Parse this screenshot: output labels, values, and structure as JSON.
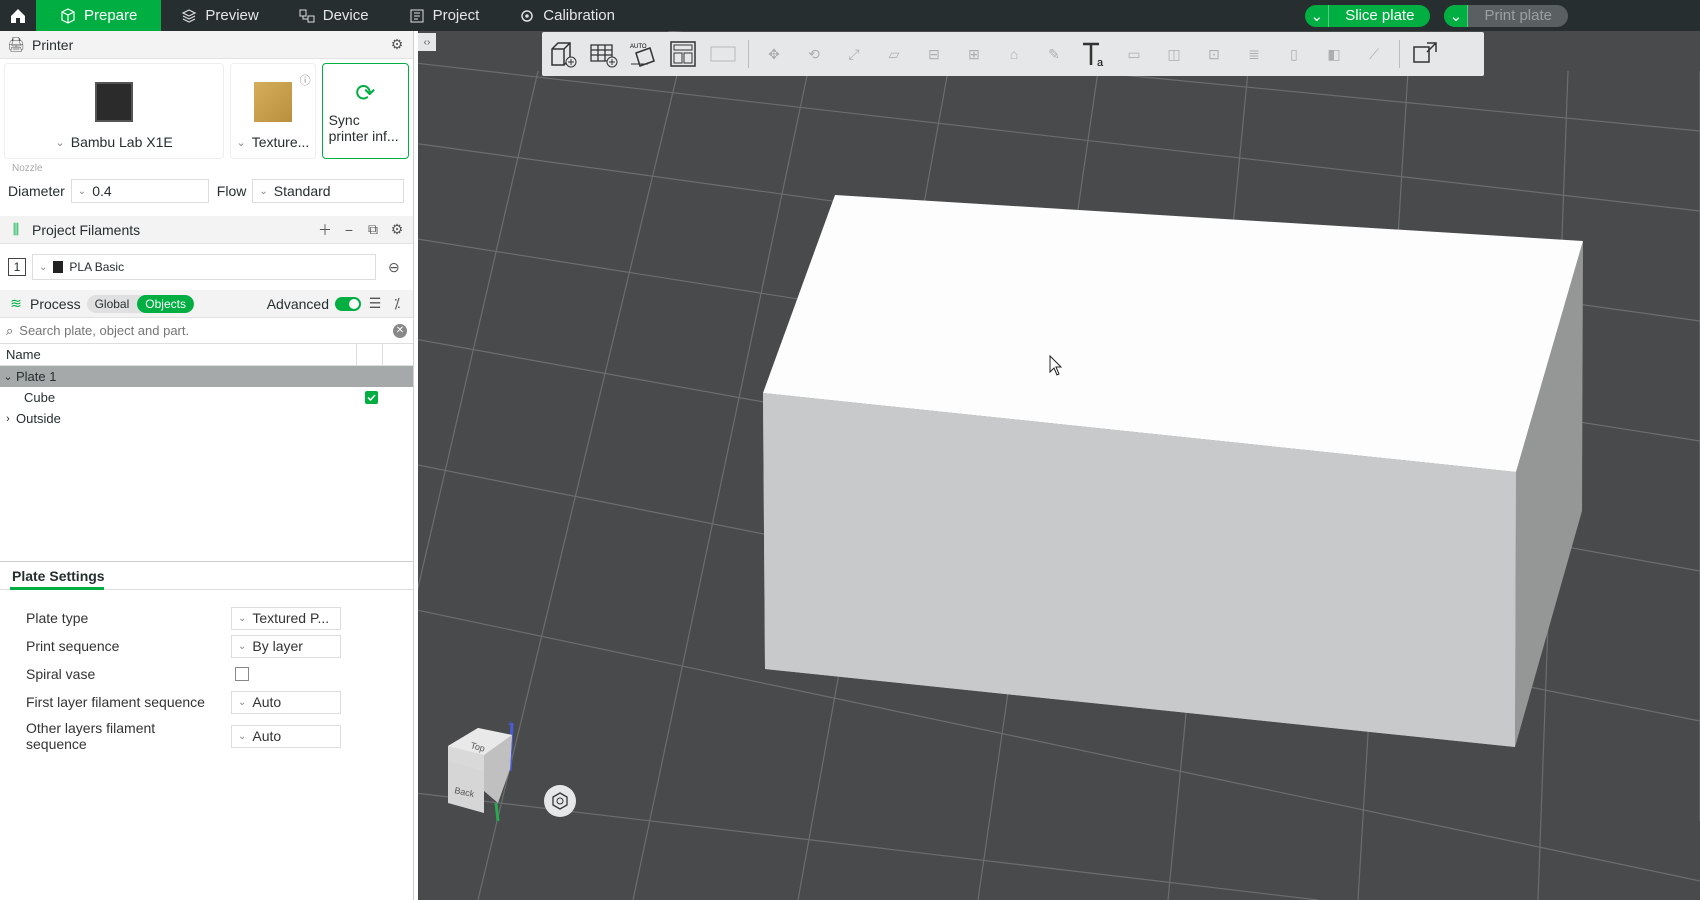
{
  "tabs": {
    "home": "home",
    "items": [
      {
        "label": "Prepare",
        "icon": "box-icon"
      },
      {
        "label": "Preview",
        "icon": "layers-icon"
      },
      {
        "label": "Device",
        "icon": "device-icon"
      },
      {
        "label": "Project",
        "icon": "project-icon"
      },
      {
        "label": "Calibration",
        "icon": "calibration-icon"
      }
    ]
  },
  "actions": {
    "slice": "Slice plate",
    "print": "Print plate"
  },
  "printer": {
    "section_title": "Printer",
    "name": "Bambu Lab X1E",
    "plate": "Texture...",
    "sync": "Sync printer inf...",
    "nozzle_label": "Nozzle",
    "diameter_label": "Diameter",
    "diameter_value": "0.4",
    "flow_label": "Flow",
    "flow_value": "Standard"
  },
  "filaments": {
    "section_title": "Project Filaments",
    "items": [
      {
        "index": "1",
        "name": "PLA Basic"
      }
    ]
  },
  "process": {
    "section_title": "Process",
    "global": "Global",
    "objects": "Objects",
    "advanced": "Advanced"
  },
  "search": {
    "placeholder": "Search plate, object and part."
  },
  "tree": {
    "header": "Name",
    "plate": "Plate 1",
    "object": "Cube",
    "outside": "Outside"
  },
  "plate_settings": {
    "title": "Plate Settings",
    "rows": [
      {
        "label": "Plate type",
        "value": "Textured P..."
      },
      {
        "label": "Print sequence",
        "value": "By layer"
      },
      {
        "label": "Spiral vase",
        "value": ""
      },
      {
        "label": "First layer filament sequence",
        "value": "Auto"
      },
      {
        "label": "Other layers filament sequence",
        "value": "Auto"
      }
    ]
  },
  "viewport": {
    "cube_faces": {
      "top": "Top",
      "back": "Back"
    },
    "axis_z": "Z",
    "colors": {
      "accent": "#00ae42",
      "bed": "#484a4b",
      "grid": "#6b6d6e"
    }
  }
}
